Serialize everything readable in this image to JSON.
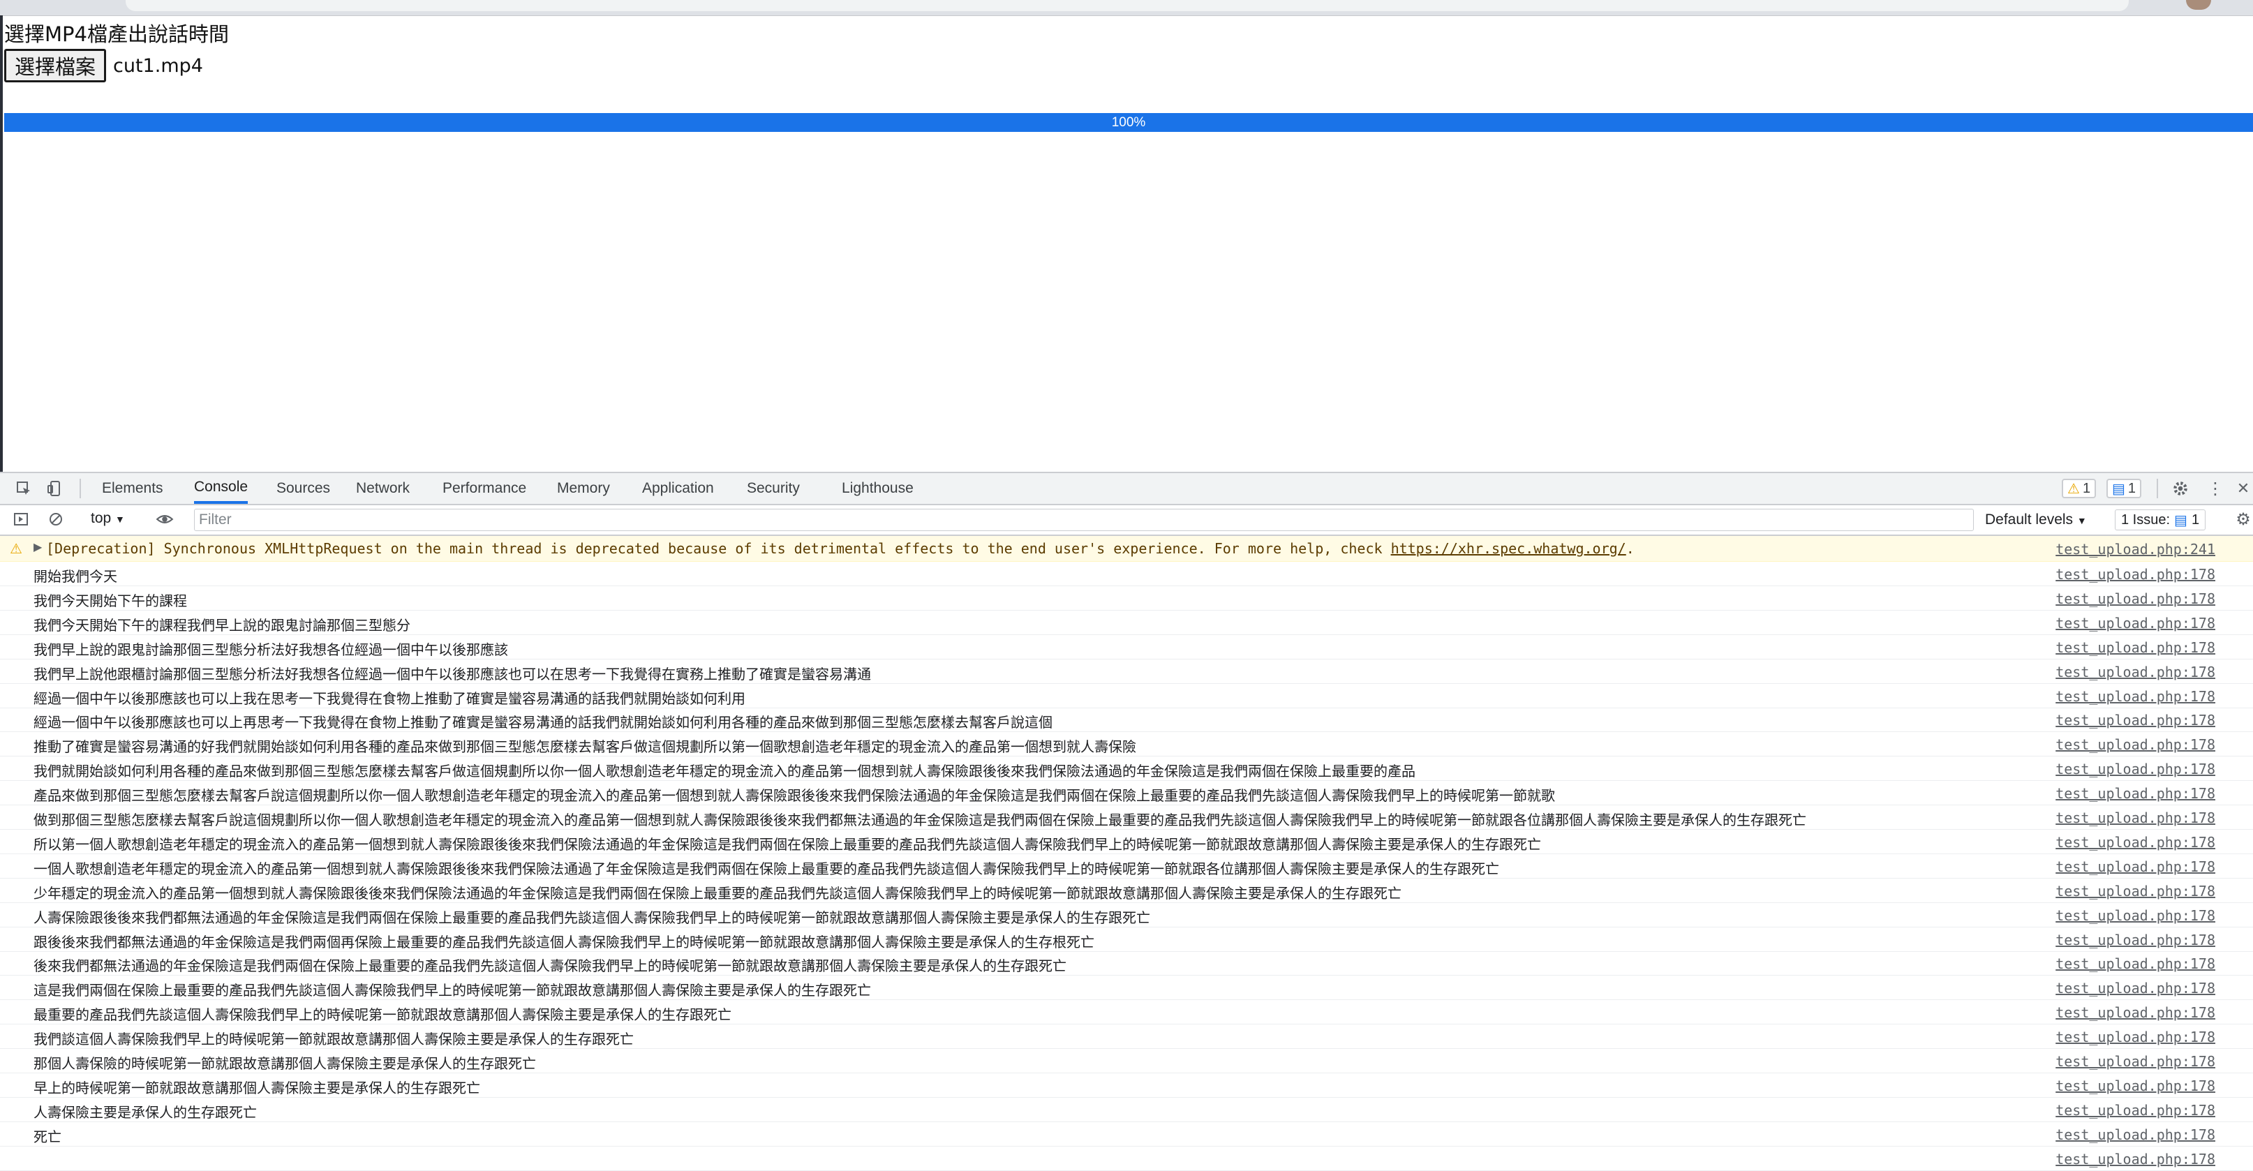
{
  "page": {
    "heading": "選擇MP4檔產出說話時間",
    "file_button_label": "選擇檔案",
    "file_name": "cut1.mp4",
    "progress": {
      "value_percent": 100,
      "label": "100%"
    }
  },
  "devtools": {
    "tabs": [
      "Elements",
      "Console",
      "Sources",
      "Network",
      "Performance",
      "Memory",
      "Application",
      "Security",
      "Lighthouse"
    ],
    "active_tab": "Console",
    "warning_count": "1",
    "message_count": "1",
    "context": "top",
    "filter_placeholder": "Filter",
    "levels_label": "Default levels",
    "issues_label": "1 Issue:",
    "issues_count": "1"
  },
  "console": {
    "warning": {
      "text": "[Deprecation] Synchronous XMLHttpRequest on the main thread is deprecated because of its detrimental effects to the end user's experience. For more help, check ",
      "link": "https://xhr.spec.whatwg.org/",
      "suffix": ".",
      "source": "test_upload.php:241"
    },
    "logs": [
      {
        "text": "開始我們今天",
        "source": "test_upload.php:178"
      },
      {
        "text": "我們今天開始下午的課程",
        "source": "test_upload.php:178"
      },
      {
        "text": "我們今天開始下午的課程我們早上說的跟鬼討論那個三型態分",
        "source": "test_upload.php:178"
      },
      {
        "text": "我們早上說的跟鬼討論那個三型態分析法好我想各位經過一個中午以後那應該",
        "source": "test_upload.php:178"
      },
      {
        "text": "我們早上說他跟櫃討論那個三型態分析法好我想各位經過一個中午以後那應該也可以在思考一下我覺得在實務上推動了確實是蠻容易溝通",
        "source": "test_upload.php:178"
      },
      {
        "text": "經過一個中午以後那應該也可以上我在思考一下我覺得在食物上推動了確實是蠻容易溝通的話我們就開始談如何利用",
        "source": "test_upload.php:178"
      },
      {
        "text": "經過一個中午以後那應該也可以上再思考一下我覺得在食物上推動了確實是蠻容易溝通的話我們就開始談如何利用各種的產品來做到那個三型態怎麼樣去幫客戶說這個",
        "source": "test_upload.php:178"
      },
      {
        "text": "推動了確實是蠻容易溝通的好我們就開始談如何利用各種的產品來做到那個三型態怎麼樣去幫客戶做這個規劃所以第一個歌想創造老年穩定的現金流入的產品第一個想到就人壽保險",
        "source": "test_upload.php:178"
      },
      {
        "text": "我們就開始談如何利用各種的產品來做到那個三型態怎麼樣去幫客戶做這個規劃所以你一個人歌想創造老年穩定的現金流入的產品第一個想到就人壽保險跟後後來我們保險法通過的年金保險這是我們兩個在保險上最重要的產品",
        "source": "test_upload.php:178"
      },
      {
        "text": "產品來做到那個三型態怎麼樣去幫客戶說這個規劃所以你一個人歌想創造老年穩定的現金流入的產品第一個想到就人壽保險跟後後來我們保險法通過的年金保險這是我們兩個在保險上最重要的產品我們先談這個人壽保險我們早上的時候呢第一節就歌",
        "source": "test_upload.php:178"
      },
      {
        "text": "做到那個三型態怎麼樣去幫客戶說這個規劃所以你一個人歌想創造老年穩定的現金流入的產品第一個想到就人壽保險跟後後來我們都無法通過的年金保險這是我們兩個在保險上最重要的產品我們先談這個人壽保險我們早上的時候呢第一節就跟各位講那個人壽保險主要是承保人的生存跟死亡",
        "source": "test_upload.php:178"
      },
      {
        "text": "所以第一個人歌想創造老年穩定的現金流入的產品第一個想到就人壽保險跟後後來我們保險法通過的年金保險這是我們兩個在保險上最重要的產品我們先談這個人壽保險我們早上的時候呢第一節就跟故意講那個人壽保險主要是承保人的生存跟死亡",
        "source": "test_upload.php:178"
      },
      {
        "text": "一個人歌想創造老年穩定的現金流入的產品第一個想到就人壽保險跟後後來我們保險法通過了年金保險這是我們兩個在保險上最重要的產品我們先談這個人壽保險我們早上的時候呢第一節就跟各位講那個人壽保險主要是承保人的生存跟死亡",
        "source": "test_upload.php:178"
      },
      {
        "text": "少年穩定的現金流入的產品第一個想到就人壽保險跟後後來我們保險法通過的年金保險這是我們兩個在保險上最重要的產品我們先談這個人壽保險我們早上的時候呢第一節就跟故意講那個人壽保險主要是承保人的生存跟死亡",
        "source": "test_upload.php:178"
      },
      {
        "text": "人壽保險跟後後來我們都無法通過的年金保險這是我們兩個在保險上最重要的產品我們先談這個人壽保險我們早上的時候呢第一節就跟故意講那個人壽保險主要是承保人的生存跟死亡",
        "source": "test_upload.php:178"
      },
      {
        "text": "跟後後來我們都無法通過的年金保險這是我們兩個再保險上最重要的產品我們先談這個人壽保險我們早上的時候呢第一節就跟故意講那個人壽保險主要是承保人的生存根死亡",
        "source": "test_upload.php:178"
      },
      {
        "text": "後來我們都無法通過的年金保險這是我們兩個在保險上最重要的產品我們先談這個人壽保險我們早上的時候呢第一節就跟故意講那個人壽保險主要是承保人的生存跟死亡",
        "source": "test_upload.php:178"
      },
      {
        "text": "這是我們兩個在保險上最重要的產品我們先談這個人壽保險我們早上的時候呢第一節就跟故意講那個人壽保險主要是承保人的生存跟死亡",
        "source": "test_upload.php:178"
      },
      {
        "text": "最重要的產品我們先談這個人壽保險我們早上的時候呢第一節就跟故意講那個人壽保險主要是承保人的生存跟死亡",
        "source": "test_upload.php:178"
      },
      {
        "text": "我們談這個人壽保險我們早上的時候呢第一節就跟故意講那個人壽保險主要是承保人的生存跟死亡",
        "source": "test_upload.php:178"
      },
      {
        "text": "那個人壽保險的時候呢第一節就跟故意講那個人壽保險主要是承保人的生存跟死亡",
        "source": "test_upload.php:178"
      },
      {
        "text": "早上的時候呢第一節就跟故意講那個人壽保險主要是承保人的生存跟死亡",
        "source": "test_upload.php:178"
      },
      {
        "text": "人壽保險主要是承保人的生存跟死亡",
        "source": "test_upload.php:178"
      },
      {
        "text": "死亡",
        "source": "test_upload.php:178"
      },
      {
        "text": "",
        "source": "test_upload.php:178"
      }
    ]
  }
}
